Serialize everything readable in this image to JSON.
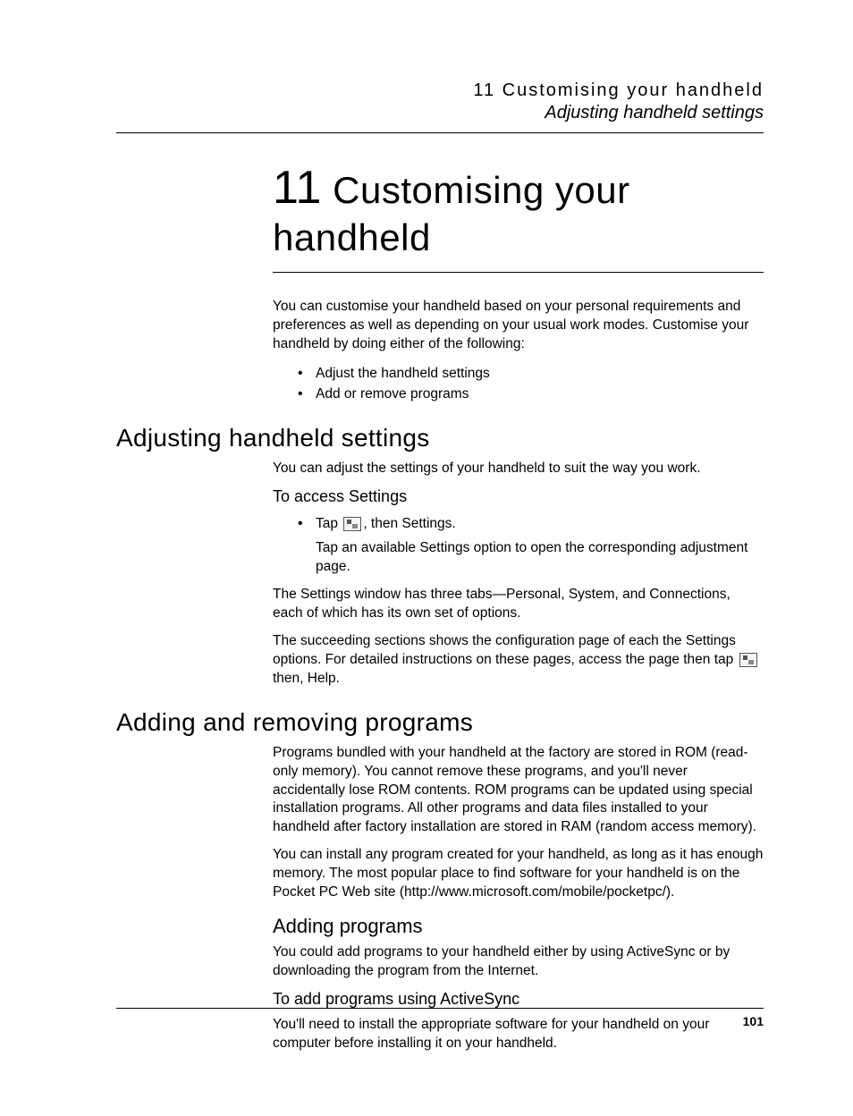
{
  "header": {
    "chapter_ref": "11 Customising your handheld",
    "section_ref": "Adjusting handheld settings"
  },
  "chapter": {
    "number": "11",
    "title": "Customising your handheld"
  },
  "intro": {
    "para": "You can customise your handheld based on your personal requirements and preferences as well as depending on your usual work modes. Customise your handheld by doing either of the following:",
    "bullets": [
      "Adjust the handheld settings",
      "Add or remove programs"
    ]
  },
  "section_adjust": {
    "heading": "Adjusting handheld settings",
    "para1": "You can adjust the settings of your handheld to suit the way you work.",
    "sub_heading": "To access Settings",
    "tap_prefix": "Tap ",
    "tap_suffix": ", then Settings.",
    "tap_detail": "Tap an available Settings option to open the corresponding adjustment page.",
    "para2": "The Settings window has three tabs—Personal, System, and Connections, each of which has its own set of options.",
    "para3_a": "The succeeding sections shows the configuration page of each the Settings options. For detailed instructions on these pages, access the page then tap ",
    "para3_b": " then, Help."
  },
  "section_programs": {
    "heading": "Adding and removing programs",
    "para1": "Programs bundled with your handheld at the factory are stored in ROM (read-only memory). You cannot remove these programs, and you'll never accidentally lose ROM contents. ROM programs can be updated using special installation programs. All other programs and data files installed to your handheld after factory installation are stored in RAM (random access memory).",
    "para2": "You can install any program created for your handheld, as long as it has enough memory. The most popular place to find software for your handheld is on the Pocket PC Web site (http://www.microsoft.com/mobile/pocketpc/).",
    "sub_heading": "Adding programs",
    "sub_para": "You could add programs to your handheld either by using ActiveSync or by downloading the program from the Internet.",
    "sub2_heading": "To add programs using ActiveSync",
    "sub2_para": "You'll need to install the appropriate software for your handheld on your computer before installing it on your handheld."
  },
  "footer": {
    "page_number": "101"
  },
  "icons": {
    "start": "start-menu-icon"
  }
}
